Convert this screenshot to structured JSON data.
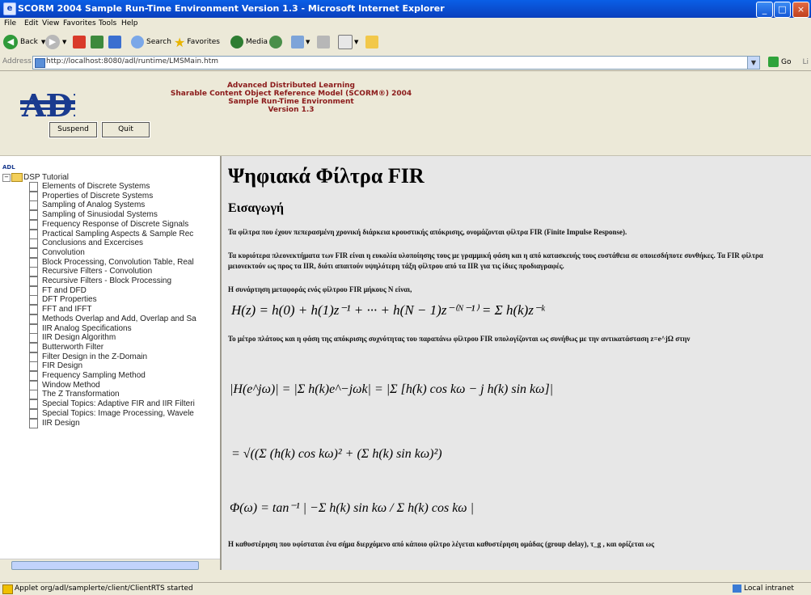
{
  "window": {
    "title": "SCORM 2004 Sample Run-Time Environment Version 1.3 - Microsoft Internet Explorer",
    "controls": [
      "_",
      "□",
      "×"
    ]
  },
  "menu": [
    "File",
    "Edit",
    "View",
    "Favorites",
    "Tools",
    "Help"
  ],
  "toolbar": {
    "back": "Back",
    "search": "Search",
    "favorites": "Favorites",
    "media": "Media"
  },
  "address": {
    "label": "Address",
    "url": "http://localhost:8080/adl/runtime/LMSMain.htm",
    "go": "Go",
    "links": "Li"
  },
  "header": {
    "lines": [
      "Advanced Distributed Learning",
      "Sharable Content Object Reference Model (SCORM®) 2004",
      "Sample Run-Time Environment",
      "Version 1.3"
    ],
    "suspend": "Suspend",
    "quit": "Quit"
  },
  "tree": {
    "root": "DSP Tutorial",
    "items": [
      "Elements of Discrete Systems",
      "Properties of Discrete Systems",
      "Sampling of Analog Systems",
      "Sampling of Sinusiodal Systems",
      "Frequency Response of Discrete Signals",
      "Practical Sampling Aspects & Sample Rec",
      "Conclusions and Excercises",
      "Convolution",
      "Block Processing, Convolution Table, Real",
      "Recursive Filters - Convolution",
      "Recursive Filters - Block Processing",
      "FT and DFD",
      "DFT Properties",
      "FFT and IFFT",
      "Methods Overlap and Add, Overlap and Sa",
      "IIR Analog Specifications",
      "IIR Design Algorithm",
      "Butterworth Filter",
      "Filter Design in the Z-Domain",
      "FIR Design",
      "Frequency Sampling Method",
      "Window Method",
      "The Z Transformation",
      "Special Topics: Adaptive FIR and IIR Filteri",
      "Special Topics: Image Processing, Wavele",
      "IIR Design"
    ]
  },
  "content": {
    "title": "Ψηφιακά Φίλτρα FIR",
    "subtitle": "Εισαγωγή",
    "p1": "Τα φίλτρα που έχουν πεπερασμένη χρονική διάρκεια κρουστικής απόκρισης, ονομάζονται φίλτρα FIR (Finite Impulse Response).",
    "p2": "Τα κυριότερα πλεονεκτήματα των FIR είναι η ευκολία υλοποίησης τους με γραμμική φάση και η από κατασκευής τους ευστάθεια σε οποιεσδήποτε συνθήκες. Τα FIR φίλτρα μειονεκτούν ως προς τα IIR, διότι απαιτούν υψηλότερη τάξη φίλτρου από τα IIR για τις ίδιες προδιαγραφές.",
    "p3": "Η συνάρτηση μεταφοράς ενός φίλτρου FIR μήκους N είναι,",
    "eq1": "H(z) = h(0) + h(1)z⁻¹ + ··· + h(N − 1)z⁻⁽ᴺ⁻¹⁾ = Σ h(k)z⁻ᵏ",
    "p4": "Το μέτρο πλάτους και η φάση της απόκρισης συχνότητας του παραπάνω φίλτρου FIR υπολογίζονται ως συνήθως με την αντικατάσταση z=e^jΩ στην",
    "eq2": "|H(e^jω)| = |Σ h(k)e^−jωk| = |Σ [h(k) cos kω − j h(k) sin kω]|",
    "eq3": "= √((Σ (h(k) cos kω)² + (Σ h(k) sin kω)²)",
    "eq4": "Φ(ω) = tan⁻¹ | −Σ h(k) sin kω / Σ h(k) cos kω |",
    "p5": "Η καθυστέρηση που υφίσταται ένα σήμα διερχόμενο από κάποιο φίλτρο λέγεται καθυστέρηση ομάδας (group delay), τ_g , και ορίζεται ως"
  },
  "status": {
    "text": "Applet org/adl/samplerte/client/ClientRTS started",
    "zone": "Local intranet"
  }
}
